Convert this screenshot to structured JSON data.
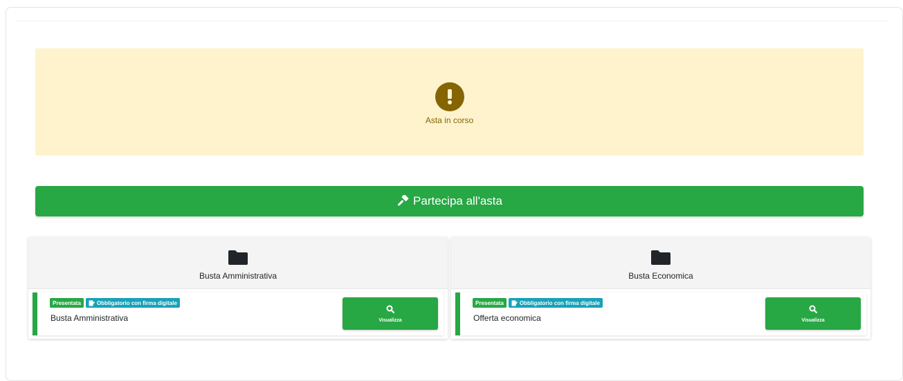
{
  "alert": {
    "text": "Asta in corso",
    "icon": "exclamation-icon",
    "color": "#856404",
    "background": "#fff3cd"
  },
  "cta": {
    "label": "Partecipa all'asta",
    "icon": "gavel-icon",
    "color": "#28a745"
  },
  "envelopes": [
    {
      "title": "Busta Amministrativa",
      "icon": "folder-icon",
      "badge_status": "Presentata",
      "badge_requirement": "Obbligatorio con firma digitale",
      "document_name": "Busta Amministrativa",
      "action_label": "Visualizza"
    },
    {
      "title": "Busta Economica",
      "icon": "folder-icon",
      "badge_status": "Presentata",
      "badge_requirement": "Obbligatorio con firma digitale",
      "document_name": "Offerta economica",
      "action_label": "Visualizza"
    }
  ]
}
